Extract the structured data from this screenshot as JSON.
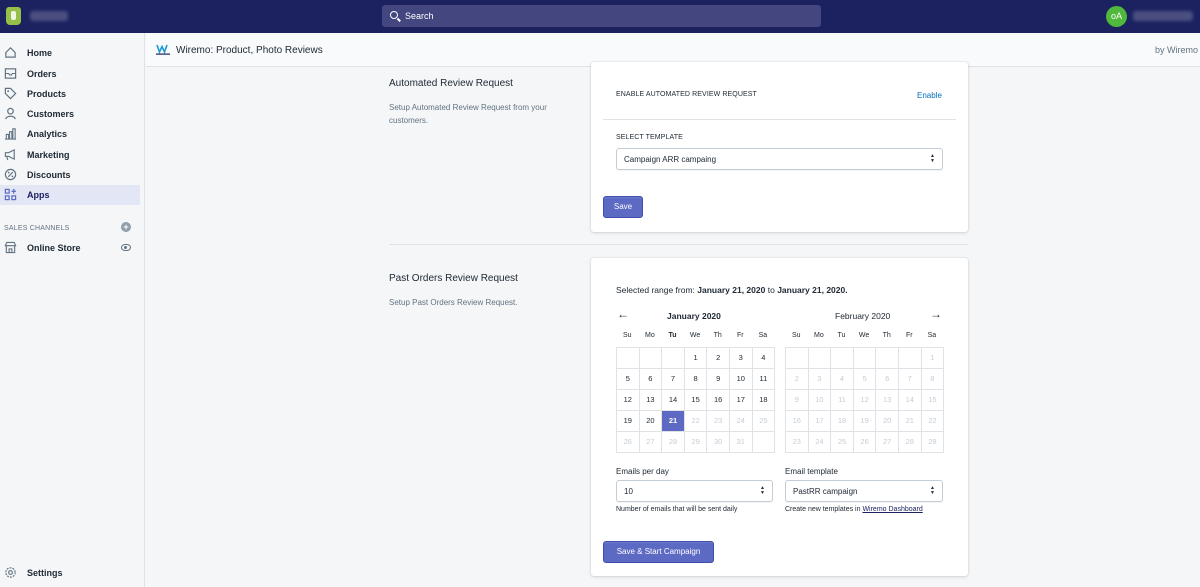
{
  "topbar": {
    "search_placeholder": "Search",
    "avatar_initials": "oA"
  },
  "sidebar": {
    "items": [
      {
        "label": "Home",
        "icon": "home-icon"
      },
      {
        "label": "Orders",
        "icon": "orders-icon"
      },
      {
        "label": "Products",
        "icon": "tag-icon"
      },
      {
        "label": "Customers",
        "icon": "person-icon"
      },
      {
        "label": "Analytics",
        "icon": "bar-chart-icon"
      },
      {
        "label": "Marketing",
        "icon": "megaphone-icon"
      },
      {
        "label": "Discounts",
        "icon": "discount-icon"
      },
      {
        "label": "Apps",
        "icon": "apps-icon"
      }
    ],
    "sales_channels_label": "SALES CHANNELS",
    "online_store_label": "Online Store",
    "settings_label": "Settings"
  },
  "appbar": {
    "title": "Wiremo: Product, Photo Reviews",
    "by": "by Wiremo"
  },
  "automated": {
    "title": "Automated Review Request",
    "description": "Setup Automated Review Request from your customers.",
    "enable_label": "ENABLE AUTOMATED REVIEW REQUEST",
    "enable_link": "Enable",
    "select_template_label": "SELECT TEMPLATE",
    "template_value": "Campaign ARR campaing",
    "save_label": "Save"
  },
  "past_orders": {
    "title": "Past Orders Review Request",
    "description": "Setup Past Orders Review Request.",
    "range_prefix": "Selected range from:",
    "range_from": "January 21, 2020",
    "range_mid": "to",
    "range_to": "January 21, 2020.",
    "month1": "January 2020",
    "month2": "February 2020",
    "weekdays": [
      "Su",
      "Mo",
      "Tu",
      "We",
      "Th",
      "Fr",
      "Sa"
    ],
    "emails_per_day_label": "Emails per day",
    "emails_per_day_value": "10",
    "emails_help": "Number of emails that will be sent daily",
    "email_template_label": "Email template",
    "email_template_value": "PastRR campaign",
    "template_help_prefix": "Create new templates in",
    "template_help_link": "Wiremo Dashboard",
    "start_label": "Save & Start Campaign"
  },
  "colors": {
    "topbar": "#1c2260",
    "accent": "#5c6ac4",
    "avatar": "#50b83c"
  }
}
